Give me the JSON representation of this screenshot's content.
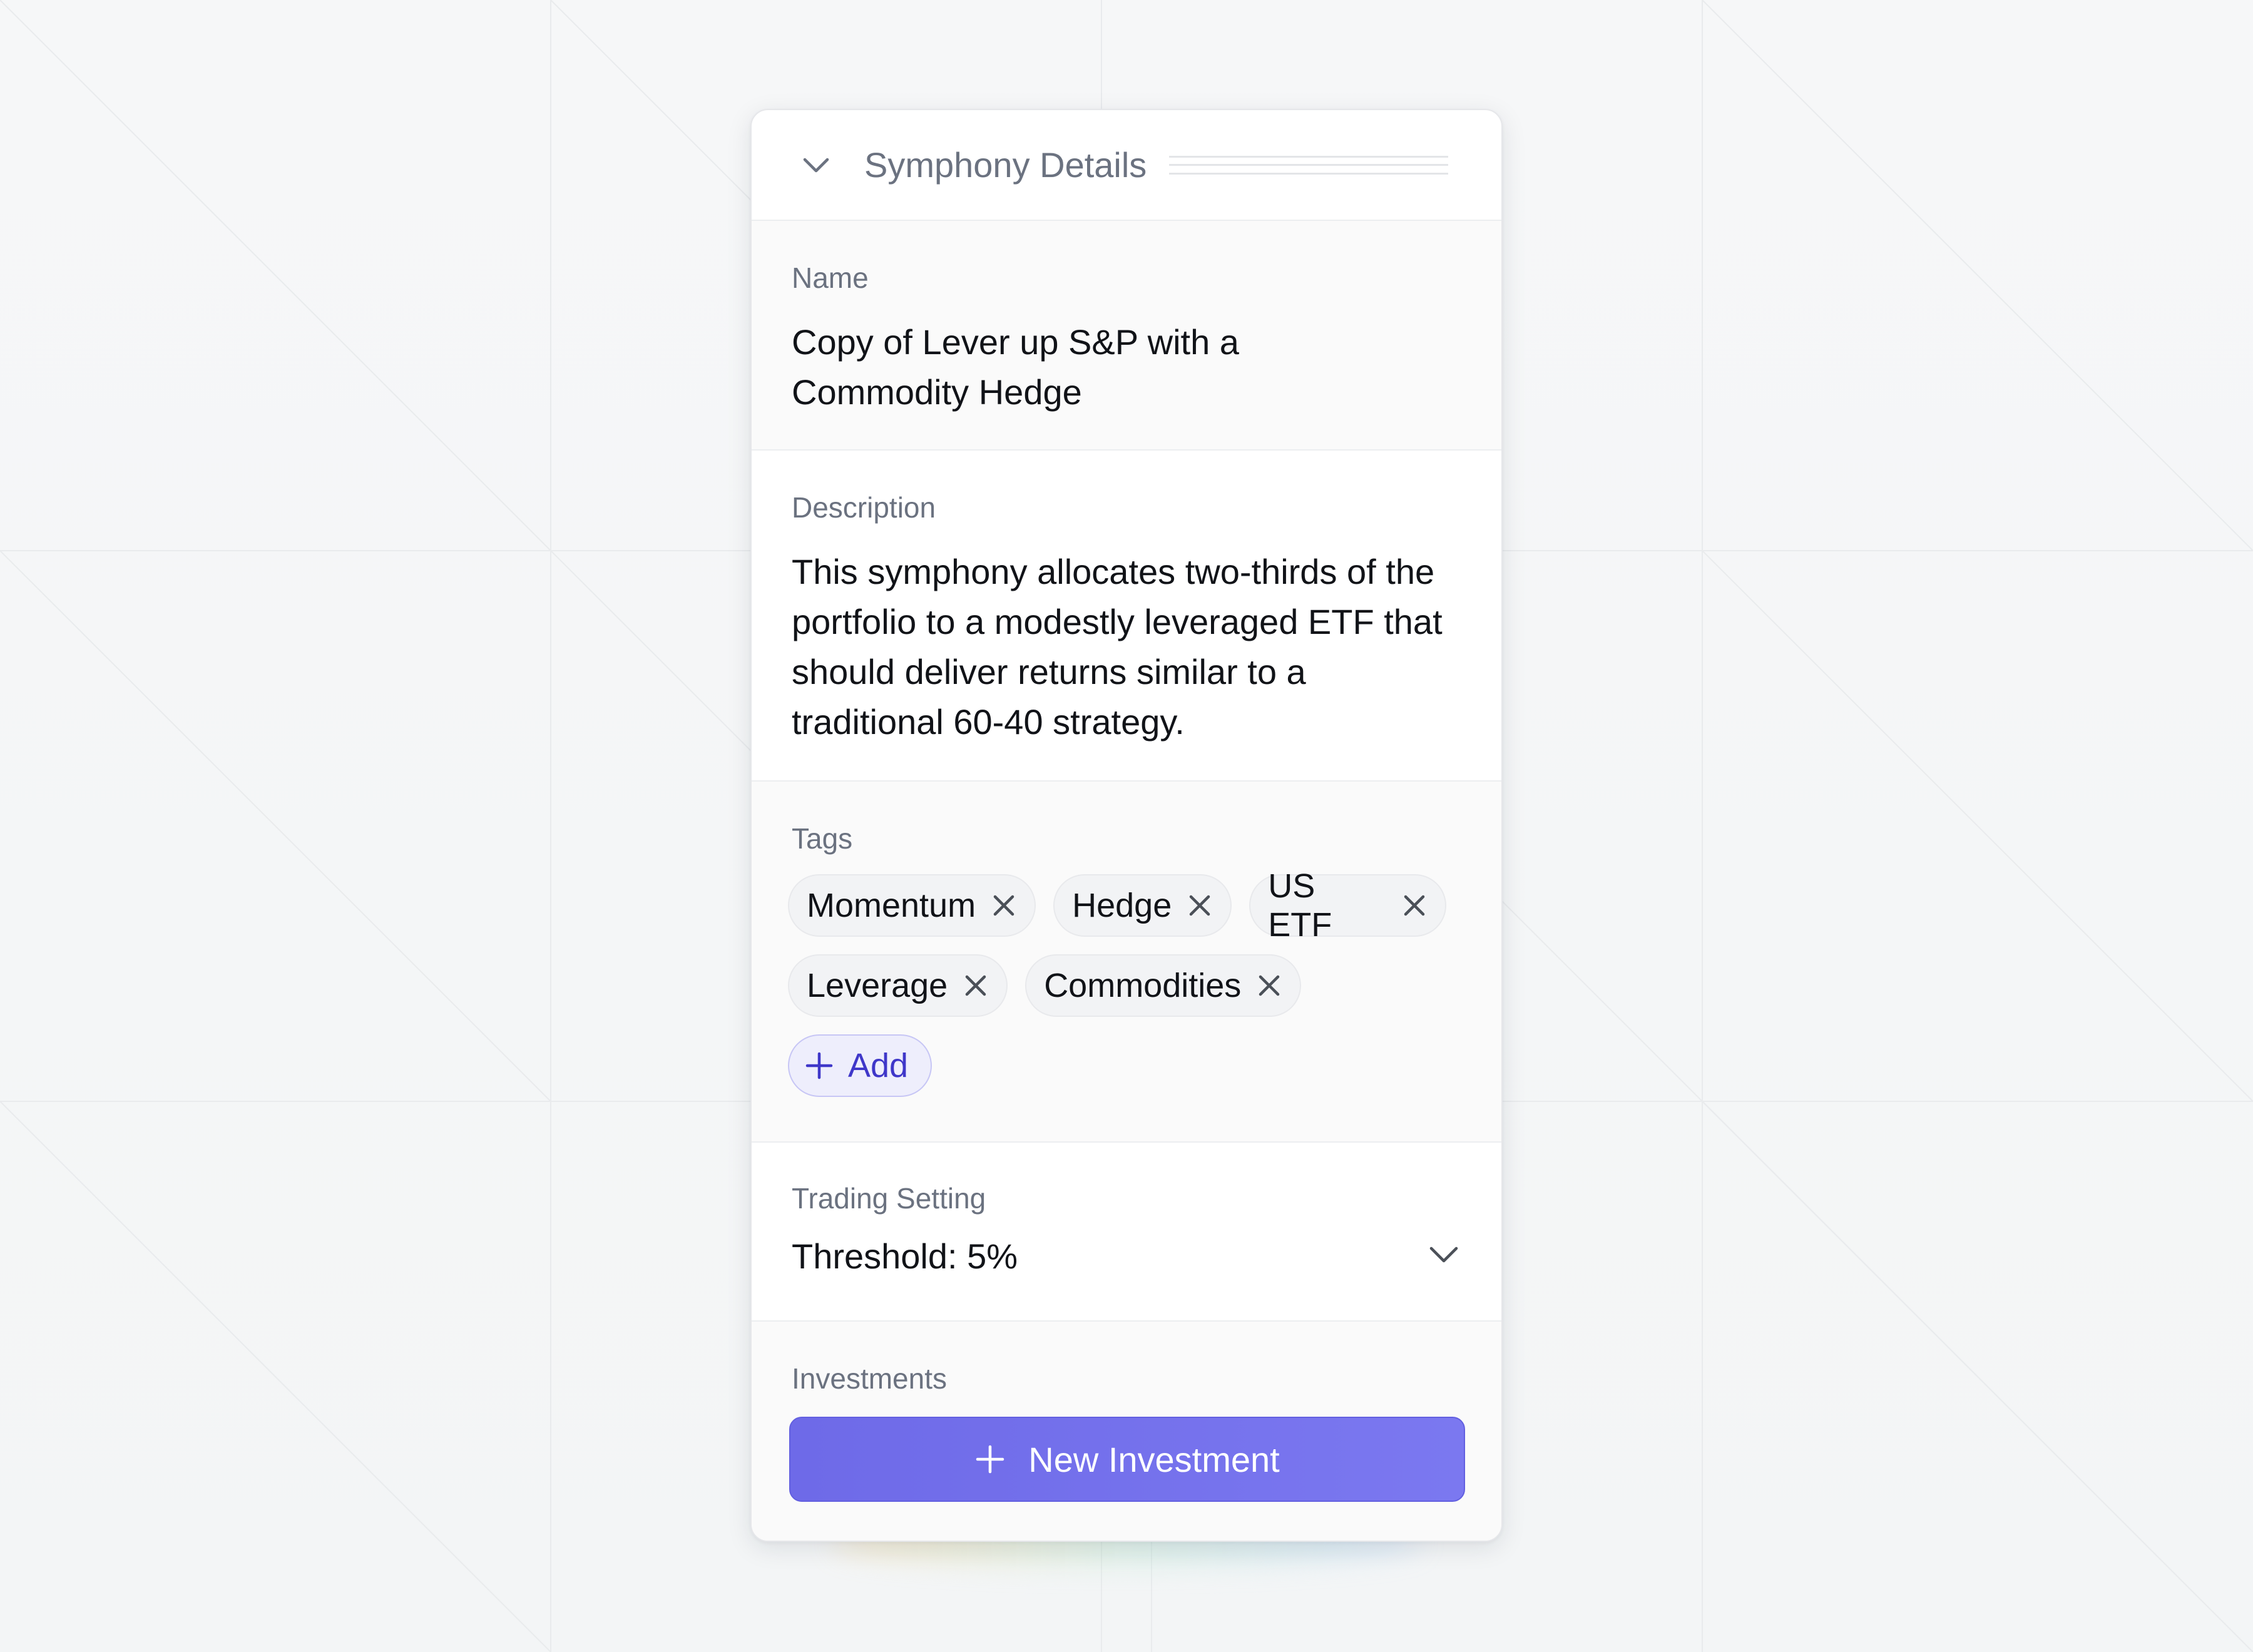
{
  "panel": {
    "title": "Symphony Details",
    "collapse_icon": "chevron-down-icon"
  },
  "name": {
    "label": "Name",
    "value": "Copy of Lever up S&P with a Commodity Hedge"
  },
  "description": {
    "label": "Description",
    "value": "This symphony allocates two-thirds of the portfolio to a modestly leveraged ETF that should deliver returns similar to a traditional 60-40 strategy."
  },
  "tags": {
    "label": "Tags",
    "items": [
      "Momentum",
      "Hedge",
      "US ETF",
      "Leverage",
      "Commodities"
    ],
    "remove_icon": "close-icon",
    "add_label": "Add",
    "add_icon": "plus-icon"
  },
  "trading": {
    "label": "Trading Setting",
    "value": "Threshold: 5%",
    "dropdown_icon": "chevron-down-icon"
  },
  "investments": {
    "label": "Investments",
    "button_label": "New Investment",
    "button_icon": "plus-icon"
  },
  "colors": {
    "accent": "#7370ED",
    "accent_text": "#3F37C9",
    "label_gray": "#6B7280",
    "text": "#111318"
  }
}
